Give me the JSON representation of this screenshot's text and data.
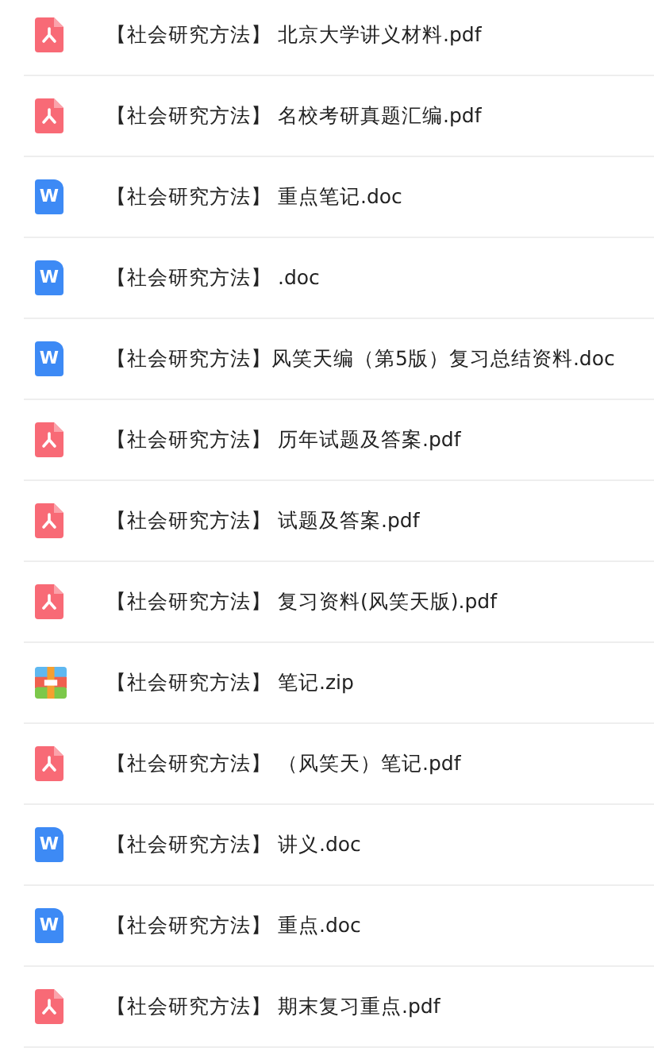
{
  "files": [
    {
      "kind": "pdf",
      "name": "【社会研究方法】 北京大学讲义材料.pdf"
    },
    {
      "kind": "pdf",
      "name": "【社会研究方法】 名校考研真题汇编.pdf"
    },
    {
      "kind": "doc",
      "icon_letter": "W",
      "name": "【社会研究方法】 重点笔记.doc"
    },
    {
      "kind": "doc",
      "icon_letter": "W",
      "name": "【社会研究方法】 .doc"
    },
    {
      "kind": "doc",
      "icon_letter": "W",
      "name": "【社会研究方法】风笑天编（第5版）复习总结资料.doc"
    },
    {
      "kind": "pdf",
      "name": "【社会研究方法】 历年试题及答案.pdf"
    },
    {
      "kind": "pdf",
      "name": "【社会研究方法】 试题及答案.pdf"
    },
    {
      "kind": "pdf",
      "name": "【社会研究方法】 复习资料(风笑天版).pdf"
    },
    {
      "kind": "zip",
      "name": "【社会研究方法】 笔记.zip"
    },
    {
      "kind": "pdf",
      "name": "【社会研究方法】 （风笑天）笔记.pdf"
    },
    {
      "kind": "doc",
      "icon_letter": "W",
      "name": "【社会研究方法】 讲义.doc"
    },
    {
      "kind": "doc",
      "icon_letter": "W",
      "name": "【社会研究方法】 重点.doc"
    },
    {
      "kind": "pdf",
      "name": "【社会研究方法】 期末复习重点.pdf"
    }
  ]
}
